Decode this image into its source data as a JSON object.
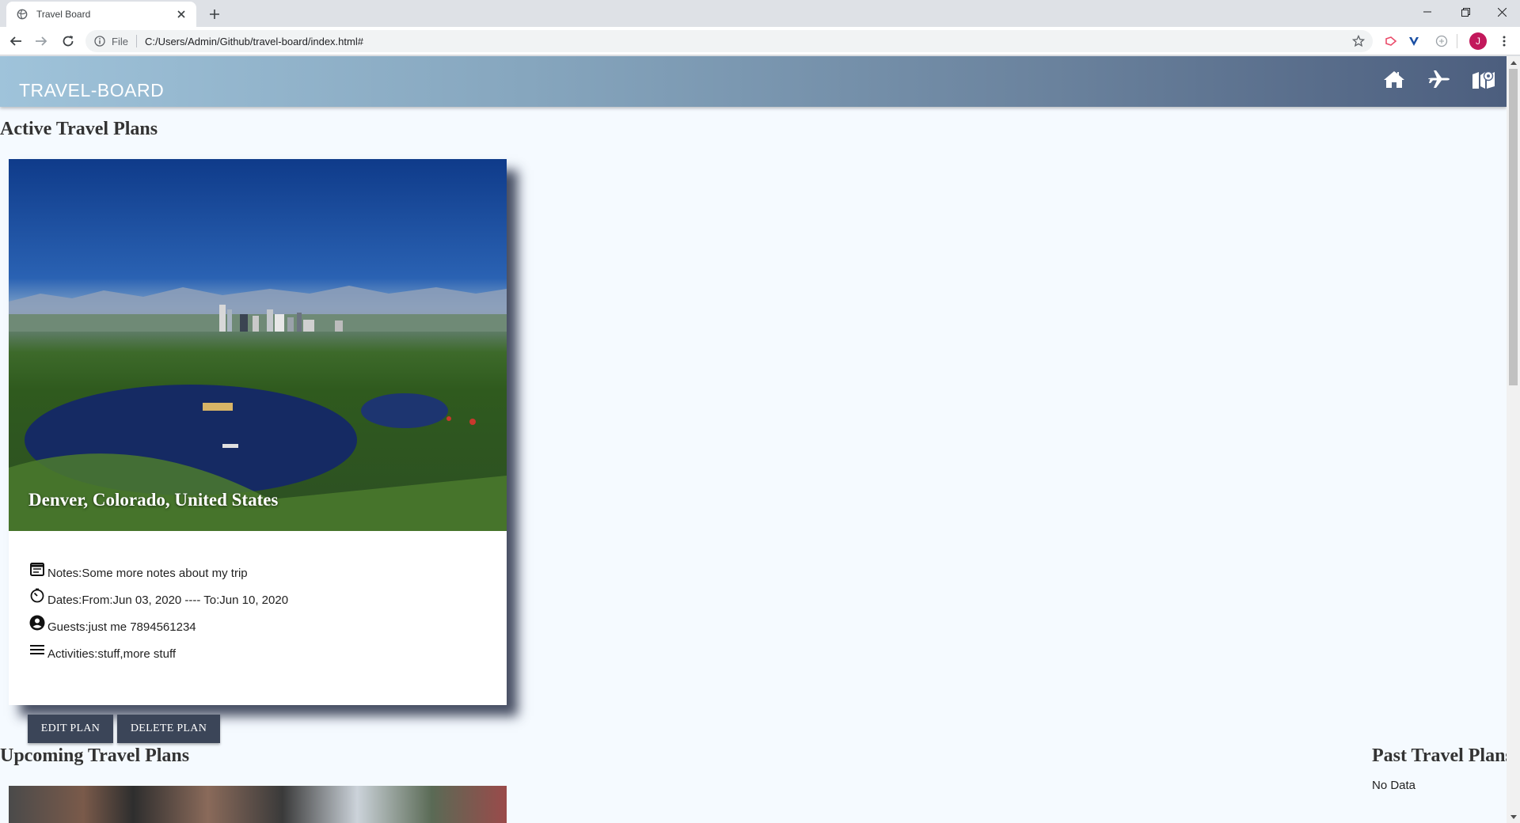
{
  "browser": {
    "tab_title": "Travel Board",
    "url_scheme": "File",
    "url": "C:/Users/Admin/Github/travel-board/index.html#",
    "profile_initial": "J"
  },
  "app": {
    "brand": "TRAVEL-BOARD",
    "nav_icons": [
      "home-icon",
      "airplane-icon",
      "map-icon"
    ],
    "header_gradient": [
      "#9fc3da",
      "#4c5e7e"
    ]
  },
  "sections": {
    "active_title": "Active Travel Plans",
    "upcoming_title": "Upcoming Travel Plans",
    "past_title": "Past Travel Plans",
    "past_empty": "No Data"
  },
  "active_plan": {
    "destination": "Denver, Colorado, United States",
    "notes": "Notes:Some more notes about my trip",
    "dates": "Dates:From:Jun 03, 2020 ---- To:Jun 10, 2020",
    "guests": "Guests:just me 7894561234",
    "activities": "Activities:stuff,more stuff",
    "edit_label": "EDIT PLAN",
    "delete_label": "DELETE PLAN",
    "button_color": "#3b4558"
  }
}
